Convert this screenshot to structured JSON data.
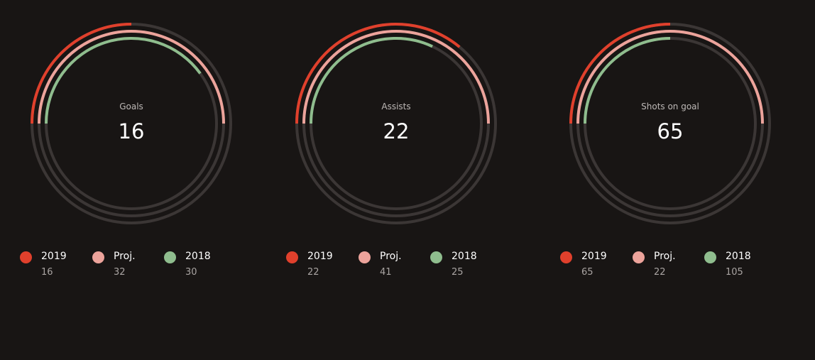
{
  "colors": {
    "background": "#181514",
    "track": "#3b3635",
    "series_2019": "#e0402c",
    "series_proj": "#eca39b",
    "series_2018": "#8fbd8e"
  },
  "chart_data": [
    {
      "type": "radial-bar",
      "label": "Goals",
      "value": "16",
      "series": [
        {
          "name": "2019",
          "value": 16,
          "fraction": 0.25,
          "color": "#e0402c"
        },
        {
          "name": "Proj.",
          "value": 32,
          "fraction": 0.5,
          "color": "#eca39b"
        },
        {
          "name": "2018",
          "value": 30,
          "fraction": 0.4,
          "color": "#8fbd8e"
        }
      ]
    },
    {
      "type": "radial-bar",
      "label": "Assists",
      "value": "22",
      "series": [
        {
          "name": "2019",
          "value": 22,
          "fraction": 0.36,
          "color": "#e0402c"
        },
        {
          "name": "Proj.",
          "value": 41,
          "fraction": 0.5,
          "color": "#eca39b"
        },
        {
          "name": "2018",
          "value": 25,
          "fraction": 0.32,
          "color": "#8fbd8e"
        }
      ]
    },
    {
      "type": "radial-bar",
      "label": "Shots on goal",
      "value": "65",
      "series": [
        {
          "name": "2019",
          "value": 65,
          "fraction": 0.25,
          "color": "#e0402c"
        },
        {
          "name": "Proj.",
          "value": 22,
          "fraction": 0.5,
          "color": "#eca39b"
        },
        {
          "name": "2018",
          "value": 105,
          "fraction": 0.25,
          "color": "#8fbd8e"
        }
      ]
    }
  ]
}
